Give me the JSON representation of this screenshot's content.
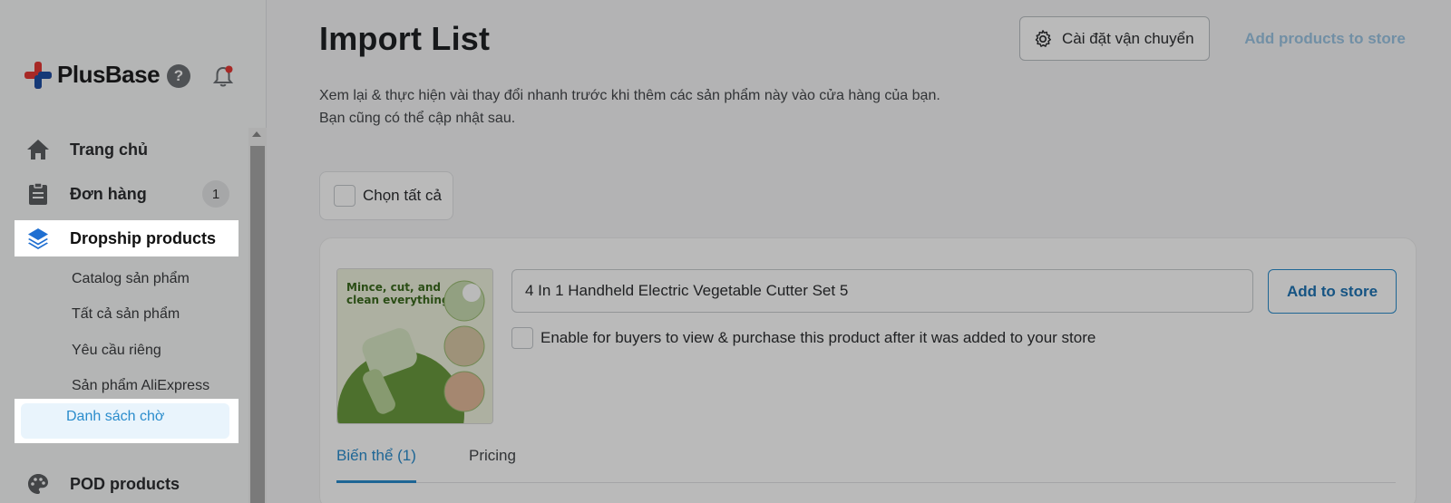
{
  "sidebar": {
    "logo_text": "PlusBase",
    "help_label": "?",
    "items": [
      {
        "label": "Trang chủ",
        "icon": "home-icon"
      },
      {
        "label": "Đơn hàng",
        "icon": "clipboard-icon",
        "badge": "1"
      },
      {
        "label": "Dropship products",
        "icon": "layers-icon"
      },
      {
        "label": "POD products",
        "icon": "palette-icon"
      }
    ],
    "sub_items": [
      {
        "label": "Catalog sản phẩm"
      },
      {
        "label": "Tất cả sản phẩm"
      },
      {
        "label": "Yêu cầu riêng"
      },
      {
        "label": "Sản phẩm AliExpress"
      },
      {
        "label": "Danh sách chờ"
      }
    ]
  },
  "header": {
    "title": "Import List",
    "shipping_button": "Cài đặt vận chuyển",
    "add_products_button": "Add products to store"
  },
  "description": {
    "line1": "Xem lại & thực hiện vài thay đổi nhanh trước khi thêm các sản phẩm này vào cửa hàng của bạn.",
    "line2": "Bạn cũng có thể cập nhật sau."
  },
  "select_all_label": "Chọn tất cả",
  "product": {
    "title": "4 In 1 Handheld Electric Vegetable Cutter Set 5",
    "add_button": "Add to store",
    "enable_label": "Enable for buyers to view & purchase this product after it was added to your store",
    "image_caption": "Mince, cut, and clean everything",
    "tabs": [
      {
        "label": "Biến thể (1)"
      },
      {
        "label": "Pricing"
      }
    ]
  },
  "colors": {
    "accent": "#2a8ccc",
    "brand_red": "#e53935",
    "brand_blue": "#1e4fa3"
  }
}
